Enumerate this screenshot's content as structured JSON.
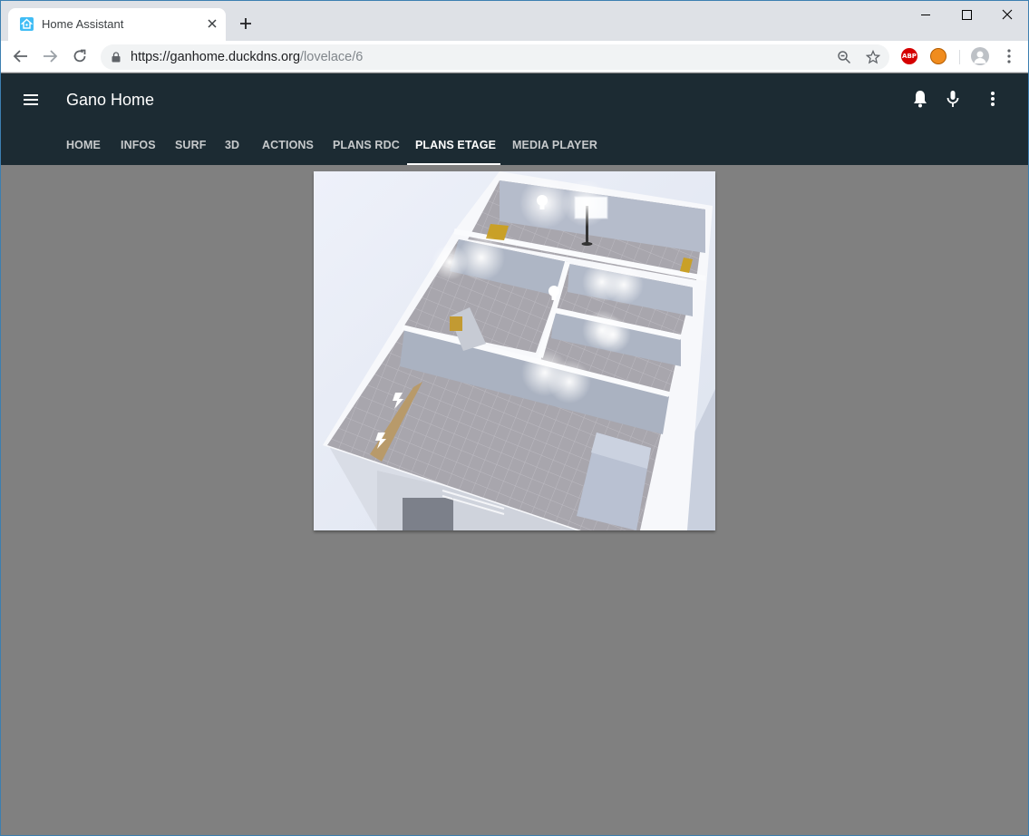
{
  "browser": {
    "tab_title": "Home Assistant",
    "url_domain": "https://ganhome.duckdns.org",
    "url_path": "/lovelace/6",
    "ext_abp_label": "ABP"
  },
  "ha": {
    "title": "Gano Home",
    "tabs": [
      {
        "label": "HOME"
      },
      {
        "label": "INFOS"
      },
      {
        "label": "SURF"
      },
      {
        "label": "3D"
      },
      {
        "label": "ACTIONS"
      },
      {
        "label": "PLANS RDC"
      },
      {
        "label": "PLANS ETAGE",
        "active": true
      },
      {
        "label": "MEDIA PLAYER"
      }
    ]
  },
  "colors": {
    "header_bg": "#1c2b33",
    "content_bg": "#808080",
    "ha_accent": "#41bdf5"
  },
  "icons": [
    "home-assistant-favicon",
    "close-icon",
    "plus-icon",
    "back-arrow-icon",
    "forward-arrow-icon",
    "reload-icon",
    "lock-icon",
    "zoom-icon",
    "star-icon",
    "menu-icon",
    "bell-icon",
    "microphone-icon",
    "more-vert-icon",
    "lightbulb-icon",
    "lightning-icon"
  ]
}
